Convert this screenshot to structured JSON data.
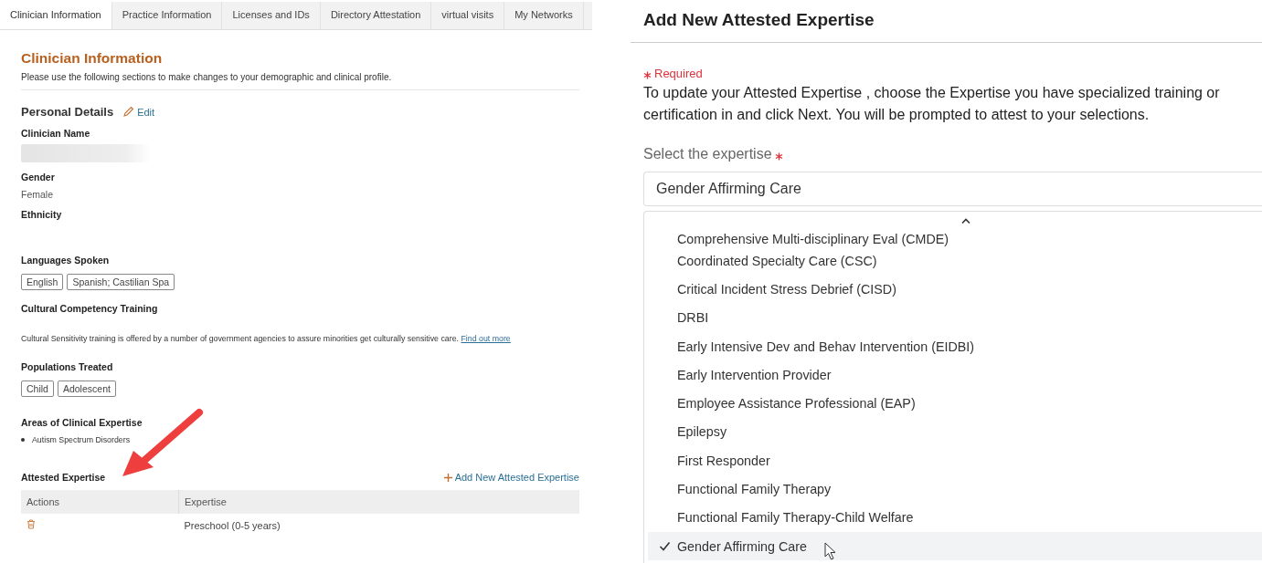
{
  "tabs": [
    {
      "label": "Clinician Information",
      "selected": true
    },
    {
      "label": "Practice Information",
      "selected": false
    },
    {
      "label": "Licenses and IDs",
      "selected": false
    },
    {
      "label": "Directory Attestation",
      "selected": false
    },
    {
      "label": "virtual visits",
      "selected": false
    },
    {
      "label": "My Networks",
      "selected": false
    }
  ],
  "profile": {
    "title": "Clinician Information",
    "intro": "Please use the following sections to make changes to your demographic and clinical profile.",
    "personal_details": {
      "title": "Personal Details",
      "edit_link": "Edit"
    },
    "fields": [
      {
        "kind": "redacted",
        "label": "Clinician Name"
      },
      {
        "kind": "text",
        "label": "Gender",
        "value": "Female"
      },
      {
        "kind": "text",
        "label": "Ethnicity"
      },
      {
        "kind": "tags",
        "label": "Languages Spoken",
        "tags": [
          "English",
          "Spanish; Castilian Spa"
        ]
      },
      {
        "kind": "paragraph",
        "label": "Cultural Competency Training",
        "text": "Cultural Sensitivity training is offered by a number of government agencies to assure minorities get culturally sensitive care.",
        "link": "Find out more"
      },
      {
        "kind": "tags",
        "label": "Populations Treated",
        "tags": [
          "Child",
          "Adolescent"
        ]
      },
      {
        "kind": "bullets",
        "label": "Areas of Clinical Expertise",
        "items": [
          "Autism Spectrum Disorders"
        ]
      }
    ],
    "attested": {
      "title": "Attested Expertise",
      "add_link": "Add New Attested Expertise",
      "columns": [
        "Actions",
        "Expertise"
      ],
      "rows": [
        {
          "expertise": "Preschool (0-5 years)"
        }
      ]
    }
  },
  "dialog": {
    "title": "Add New Attested Expertise",
    "required_note": "Required",
    "description": "To update your Attested Expertise , choose the Expertise you have specialized training or certification in and click Next. You will be prompted to attest to your selections.",
    "select": {
      "label": "Select the expertise",
      "value": "Gender Affirming Care",
      "options": [
        {
          "label": "Comprehensive Multi-disciplinary Eval (CMDE)",
          "selected": false
        },
        {
          "label": "Coordinated Specialty Care (CSC)",
          "selected": false
        },
        {
          "label": "Critical Incident Stress Debrief (CISD)",
          "selected": false
        },
        {
          "label": "DRBI",
          "selected": false
        },
        {
          "label": "Early Intensive Dev and Behav Intervention (EIDBI)",
          "selected": false
        },
        {
          "label": "Early Intervention Provider",
          "selected": false
        },
        {
          "label": "Employee Assistance Professional (EAP)",
          "selected": false
        },
        {
          "label": "Epilepsy",
          "selected": false
        },
        {
          "label": "First Responder",
          "selected": false
        },
        {
          "label": "Functional Family Therapy",
          "selected": false
        },
        {
          "label": "Functional Family Therapy-Child Welfare",
          "selected": false
        },
        {
          "label": "Gender Affirming Care",
          "selected": true
        }
      ]
    }
  }
}
